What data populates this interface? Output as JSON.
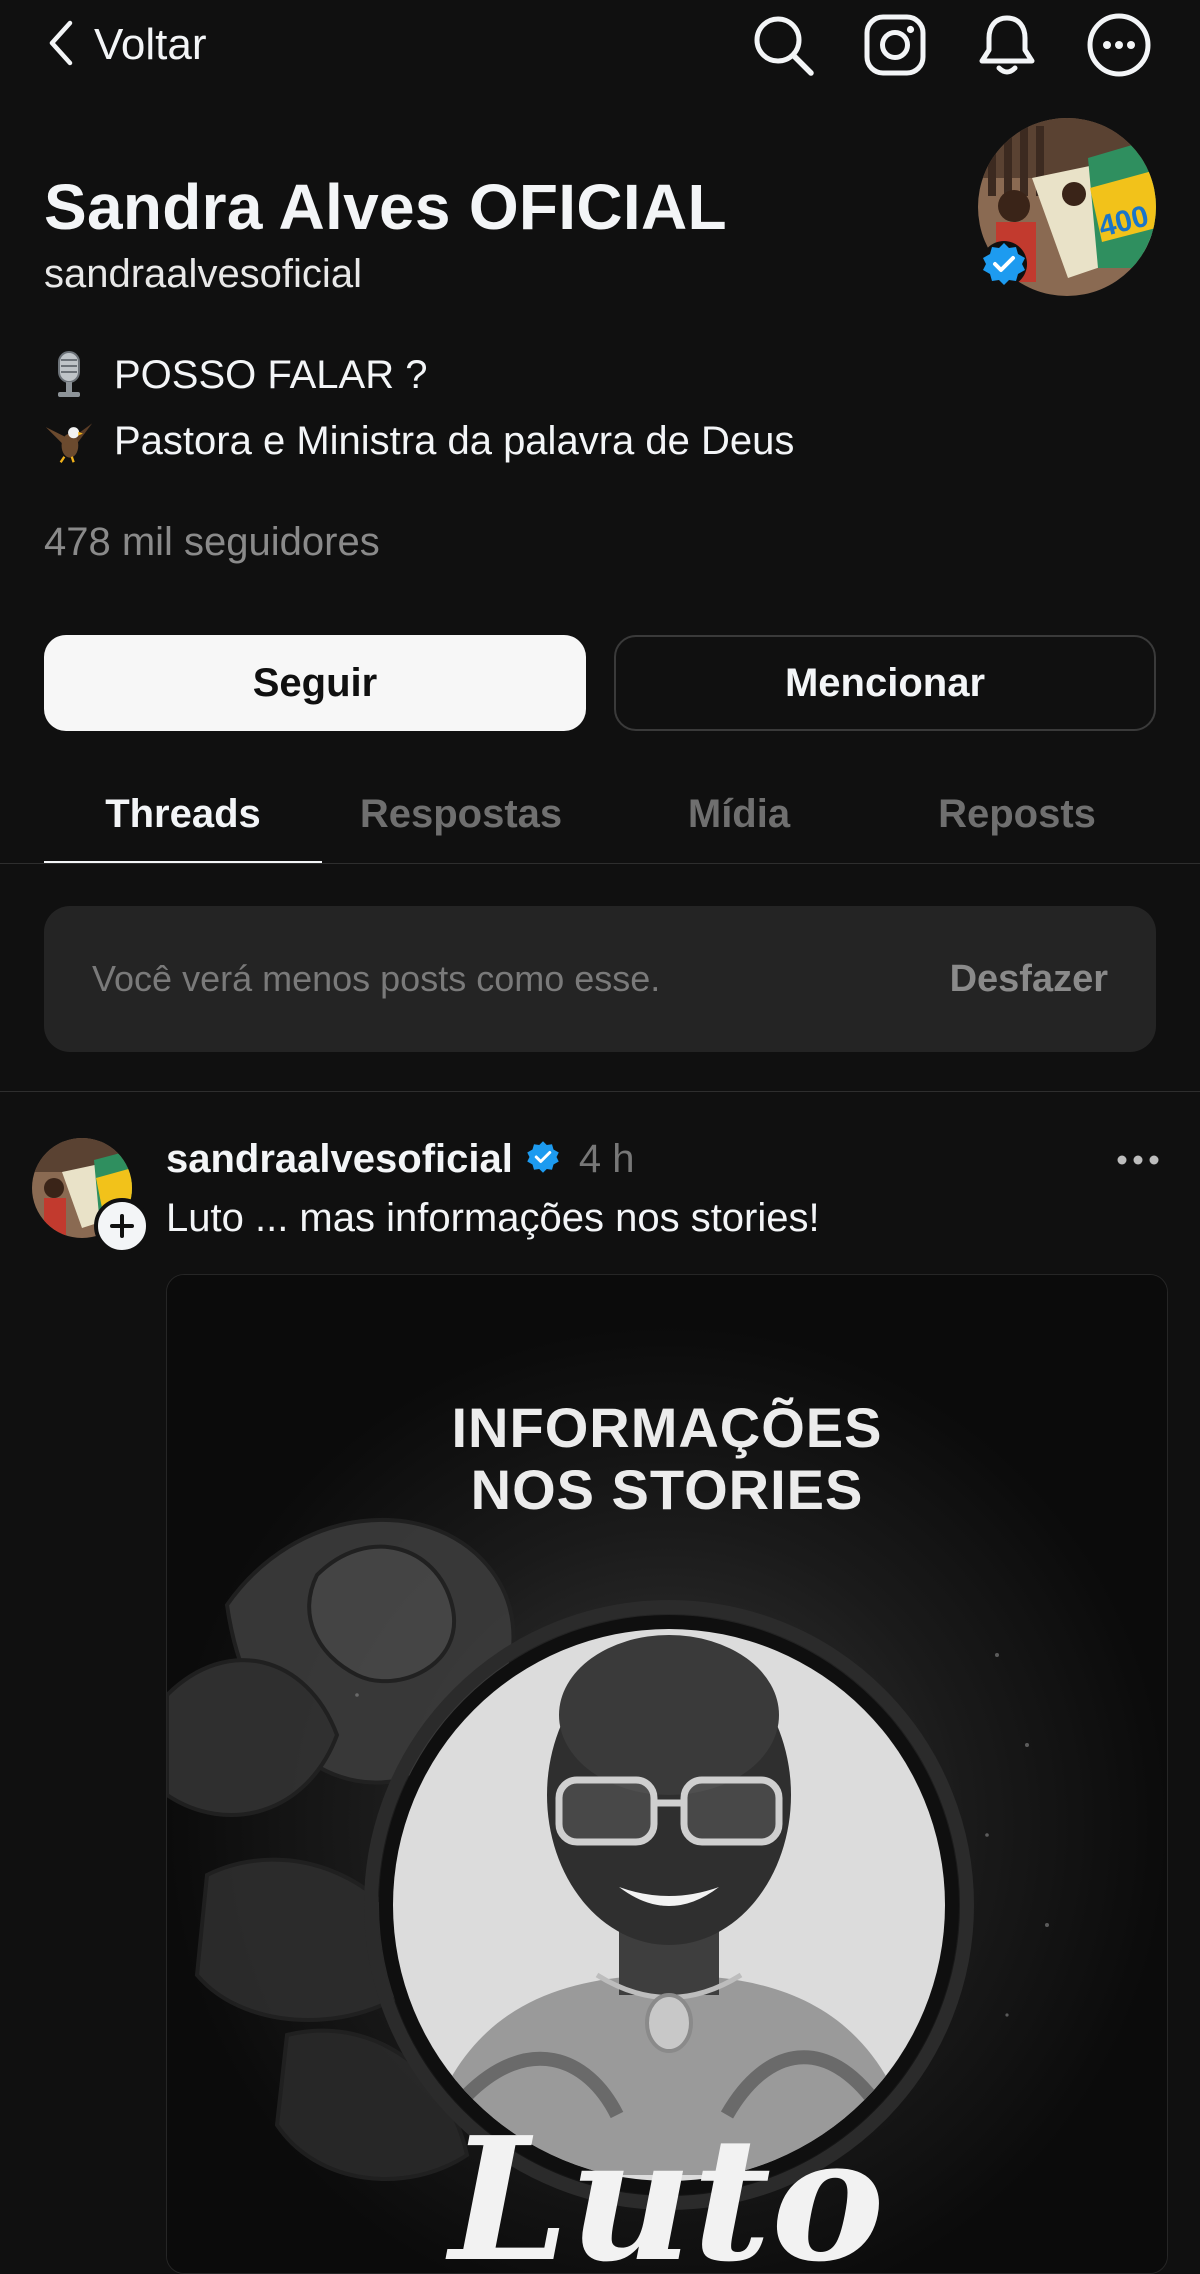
{
  "header": {
    "back_label": "Voltar",
    "icons": [
      "search-icon",
      "instagram-icon",
      "bell-icon",
      "more-circle-icon"
    ]
  },
  "profile": {
    "name": "Sandra Alves OFICIAL",
    "handle": "sandraalvesoficial",
    "bio": [
      {
        "emoji": "microphone-icon",
        "text": "POSSO FALAR ?"
      },
      {
        "emoji": "eagle-icon",
        "text": "Pastora e Ministra da palavra de Deus"
      }
    ],
    "followers": "478 mil seguidores",
    "follow_label": "Seguir",
    "mention_label": "Mencionar",
    "avatar_badge_number": "400"
  },
  "tabs": [
    {
      "label": "Threads",
      "active": true
    },
    {
      "label": "Respostas",
      "active": false
    },
    {
      "label": "Mídia",
      "active": false
    },
    {
      "label": "Reposts",
      "active": false
    }
  ],
  "notice": {
    "text": "Você verá menos posts como esse.",
    "undo_label": "Desfazer"
  },
  "post": {
    "username": "sandraalvesoficial",
    "time": "4 h",
    "text": "Luto ... mas informações nos stories!",
    "media": {
      "title_line1": "INFORMAÇÕES",
      "title_line2": "NOS STORIES",
      "script_text": "Luto"
    }
  },
  "colors": {
    "background": "#101010",
    "verified": "#1d9bf0",
    "text_primary": "#f3f5f7",
    "text_muted": "#8a8a8a"
  }
}
